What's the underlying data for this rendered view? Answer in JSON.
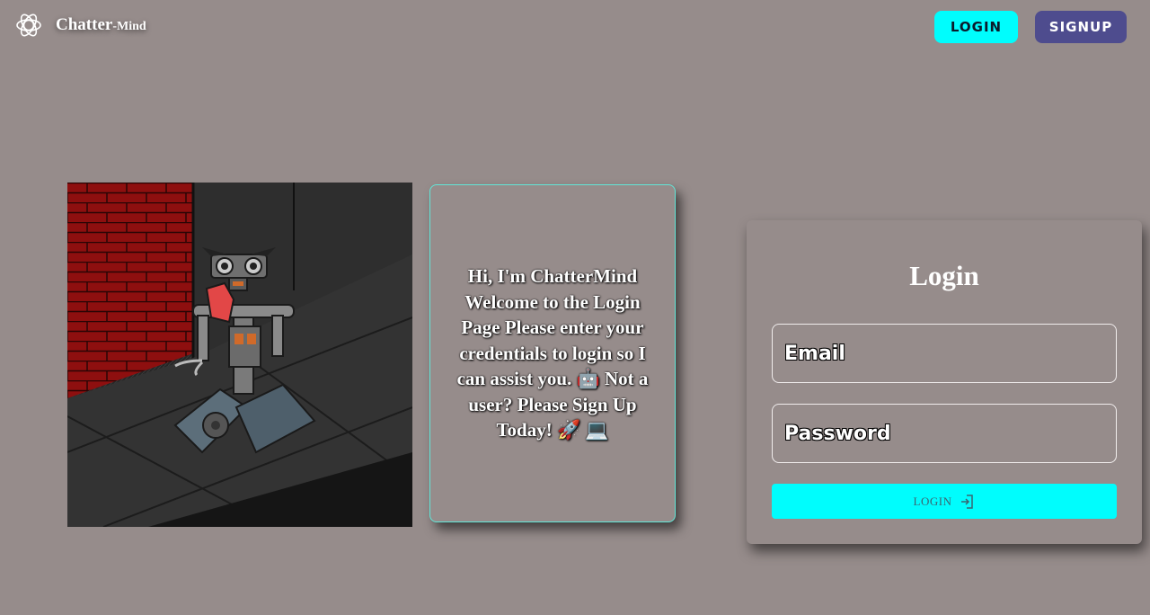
{
  "header": {
    "brand_name_big": "Chatter",
    "brand_name_small": "-Mind",
    "login_label": "LOGIN",
    "signup_label": "SIGNUP"
  },
  "intro": {
    "message": "Hi, I'm ChatterMind Welcome to the Login Page Please enter your credentials to login so I can assist you. 🤖 Not a user? Please Sign Up Today! 🚀 💻"
  },
  "login_form": {
    "title": "Login",
    "email_placeholder": "Email",
    "password_placeholder": "Password",
    "submit_label": "LOGIN"
  },
  "colors": {
    "background": "#968c8b",
    "accent_cyan": "#00fdfd",
    "signup_purple": "#4e4c8e",
    "card_border": "#62e6d8"
  },
  "icons": {
    "brand": "openai-logo-icon",
    "submit": "login-arrow-icon"
  }
}
